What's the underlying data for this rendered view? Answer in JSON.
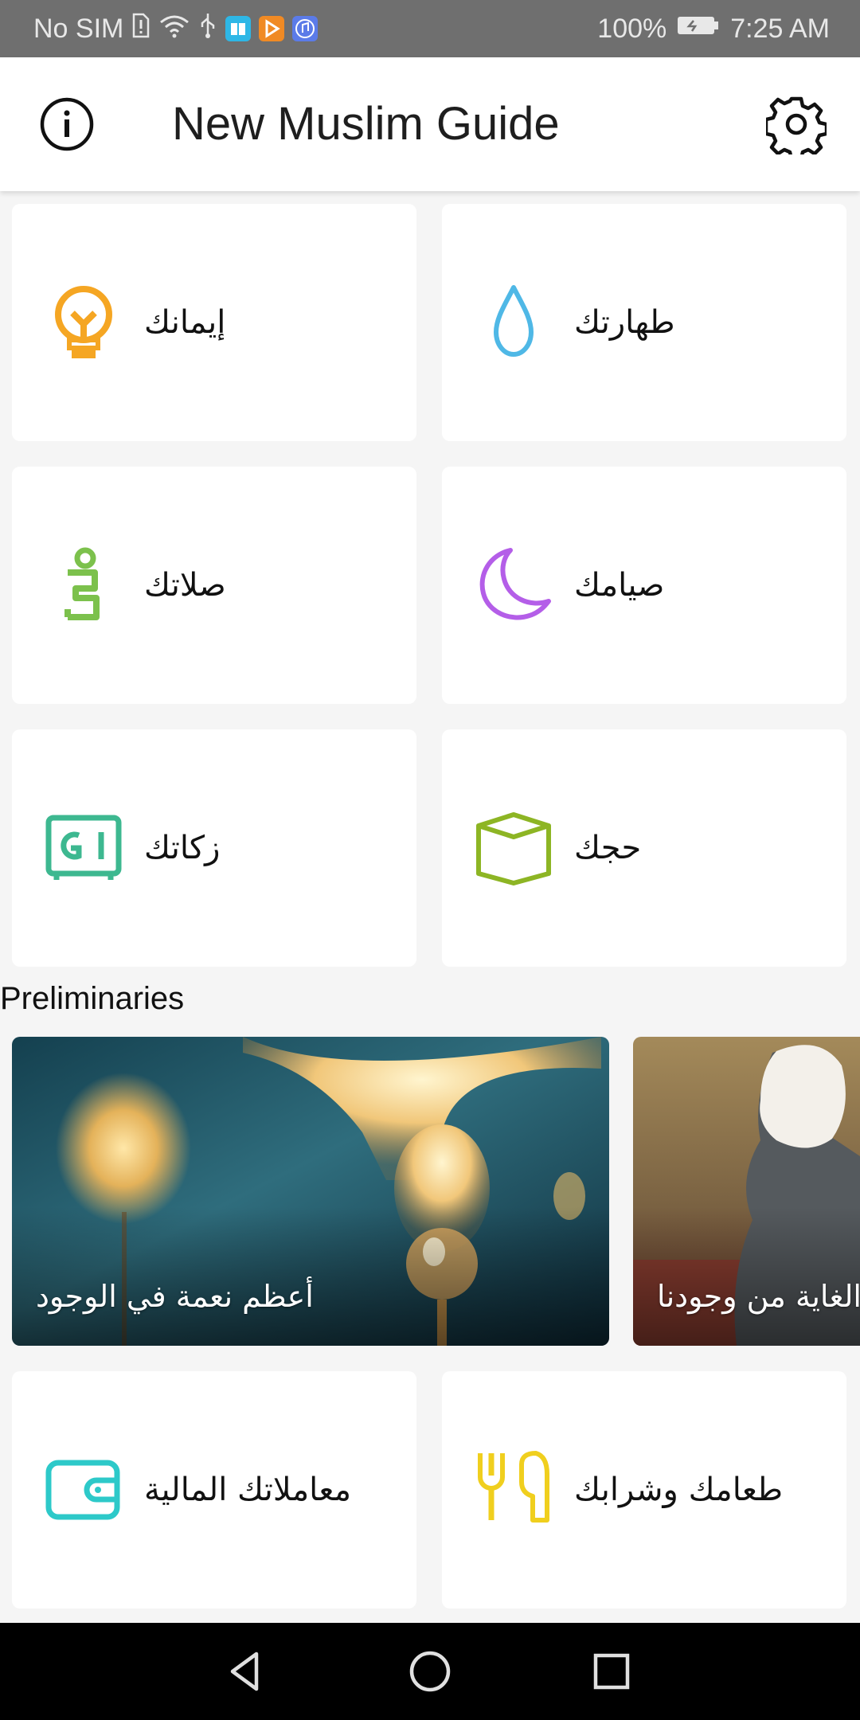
{
  "status_bar": {
    "carrier": "No SIM",
    "battery": "100%",
    "time": "7:25 AM"
  },
  "app_bar": {
    "title": "New Muslim Guide"
  },
  "topics": [
    {
      "label": "إيمانك",
      "icon": "lightbulb-icon",
      "color": "#F5A623"
    },
    {
      "label": "طهارتك",
      "icon": "water-drop-icon",
      "color": "#4FB8E6"
    },
    {
      "label": "صلاتك",
      "icon": "prayer-icon",
      "color": "#7CC14C"
    },
    {
      "label": "صيامك",
      "icon": "crescent-moon-icon",
      "color": "#B45EE8"
    },
    {
      "label": "زكاتك",
      "icon": "safe-icon",
      "color": "#3DB890"
    },
    {
      "label": "حجك",
      "icon": "kaaba-icon",
      "color": "#8DB524"
    }
  ],
  "preliminaries": {
    "title": "Preliminaries",
    "items": [
      {
        "label": "أعظم نعمة في الوجود"
      },
      {
        "label": "الغاية من وجودنا"
      }
    ]
  },
  "more_topics": [
    {
      "label": "معاملاتك المالية",
      "icon": "wallet-icon",
      "color": "#2DC9C9"
    },
    {
      "label": "طعامك وشرابك",
      "icon": "fork-knife-icon",
      "color": "#F0CF1E"
    }
  ]
}
